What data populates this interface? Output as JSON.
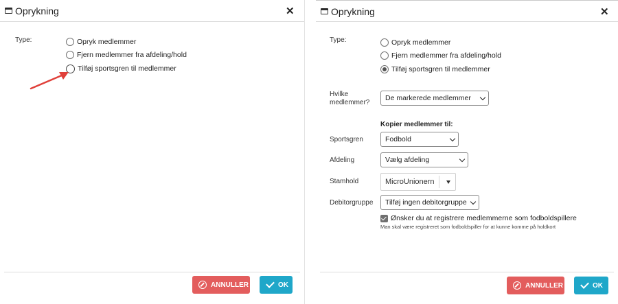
{
  "dialog_title": "Oprykning",
  "close_glyph": "✕",
  "left": {
    "type_label": "Type:",
    "options": [
      "Opryk medlemmer",
      "Fjern medlemmer fra afdeling/hold",
      "Tilføj sportsgren til medlemmer"
    ],
    "cancel_label": "ANNULLER",
    "ok_label": "OK"
  },
  "right": {
    "type_label": "Type:",
    "options": [
      "Opryk medlemmer",
      "Fjern medlemmer fra afdeling/hold",
      "Tilføj sportsgren til medlemmer"
    ],
    "selected_option": "Tilføj sportsgren til medlemmer",
    "which_members_label_1": "Hvilke",
    "which_members_label_2": "medlemmer?",
    "which_members_value": "De markerede medlemmer",
    "copy_heading": "Kopier medlemmer til:",
    "sport_label": "Sportsgren",
    "sport_value": "Fodbold",
    "department_label": "Afdeling",
    "department_value": "Vælg afdeling",
    "team_label": "Stamhold",
    "team_value": "MicroUnionern",
    "debtor_label": "Debitorgruppe",
    "debtor_value": "Tilføj ingen debitorgruppe",
    "register_checkbox_label": "Ønsker du at registrere medlemmerne som fodboldspillere",
    "register_note": "Man skal være registreret som fodboldspiller for at kunne komme på holdkort",
    "register_checked": true,
    "cancel_label": "ANNULLER",
    "ok_label": "OK"
  },
  "colors": {
    "cancel": "#e35d5d",
    "ok": "#1fa7c9",
    "annotation_arrow": "#e0403a"
  },
  "icons": {
    "window": "window-icon",
    "close": "close-icon",
    "cancel": "ban-icon",
    "ok": "checkmark-icon"
  }
}
